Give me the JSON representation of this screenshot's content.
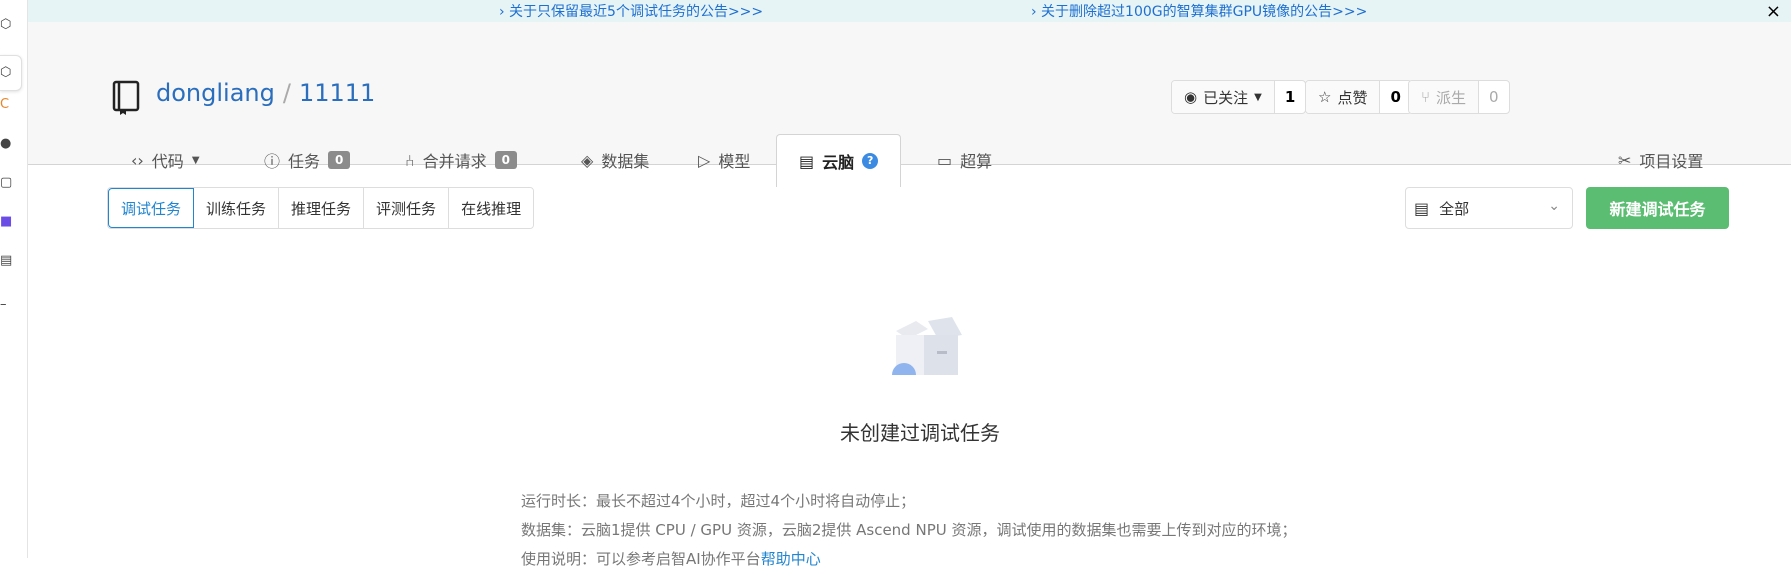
{
  "notices": {
    "left": "›  关于只保留最近5个调试任务的公告>>>",
    "right": "›  关于删除超过100G的智算集群GPU镜像的公告>>>",
    "close": "×"
  },
  "repo": {
    "owner": "dongliang",
    "separator": "/",
    "name": "11111"
  },
  "actions": {
    "watch_label": "已关注",
    "watch_count": "1",
    "star_label": "点赞",
    "star_count": "0",
    "fork_label": "派生",
    "fork_count": "0"
  },
  "tabs": {
    "code": "代码",
    "issues": "任务",
    "issues_count": "0",
    "pulls": "合并请求",
    "pulls_count": "0",
    "datasets": "数据集",
    "models": "模型",
    "cloudbrain": "云脑",
    "cloudbrain_help": "?",
    "supercompute": "超算",
    "settings": "项目设置"
  },
  "subtabs": [
    "调试任务",
    "训练任务",
    "推理任务",
    "评测任务",
    "在线推理"
  ],
  "filter": {
    "value": "全部"
  },
  "new_button": "新建调试任务",
  "empty": {
    "title": "未创建过调试任务",
    "lines": [
      "运行时长：最长不超过4个小时，超过4个小时将自动停止；",
      "数据集：云脑1提供 CPU / GPU 资源，云脑2提供 Ascend NPU 资源，调试使用的数据集也需要上传到对应的环境；"
    ],
    "line3_prefix": "使用说明：可以参考启智AI协作平台",
    "line3_link": "帮助中心"
  },
  "colors": {
    "accent": "#2185d0",
    "primary_button": "#5bbd72",
    "notice_bg": "#e6f4f6",
    "link": "#2a6ebd"
  }
}
